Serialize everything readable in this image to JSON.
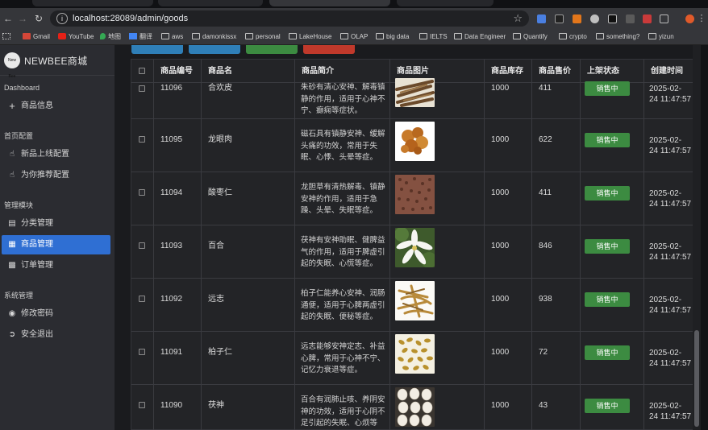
{
  "browser": {
    "url": "localhost:28089/admin/goods",
    "bookmarks": [
      "Gmail",
      "YouTube",
      "地图",
      "翻译",
      "aws",
      "damonkissx",
      "personal",
      "LakeHouse",
      "OLAP",
      "big data",
      "IELTS",
      "Data Engineer",
      "Quantify",
      "crypto",
      "something?",
      "yizun"
    ]
  },
  "sidebar": {
    "brand": "NEWBEE商城",
    "logo_text": "New Bee",
    "sections": {
      "dashboard": "Dashboard",
      "homepage": "首页配置",
      "modules": "管理模块",
      "system": "系统管理"
    },
    "items": {
      "goods_info": "商品信息",
      "new_config": "新品上线配置",
      "recommend_config": "为你推荐配置",
      "category": "分类管理",
      "goods": "商品管理",
      "orders": "订单管理",
      "password": "修改密码",
      "logout": "安全退出"
    }
  },
  "table": {
    "headers": [
      "商品编号",
      "商品名",
      "商品简介",
      "商品图片",
      "商品库存",
      "商品售价",
      "上架状态",
      "创建时间"
    ],
    "rows": [
      {
        "id": "11096",
        "name": "合欢皮",
        "desc": "朱砂有清心安神、解毒镇静的作用，适用于心神不宁、癫痫等症状。",
        "stock": "1000",
        "price": "411",
        "status": "销售中",
        "time1": "2025-02-",
        "time2": "24 11:47:57"
      },
      {
        "id": "11095",
        "name": "龙眼肉",
        "desc": "磁石具有镇静安神、缓解头痛的功效，常用于失眠、心悸、头晕等症。",
        "stock": "1000",
        "price": "622",
        "status": "销售中",
        "time1": "2025-02-",
        "time2": "24 11:47:57"
      },
      {
        "id": "11094",
        "name": "酸枣仁",
        "desc": "龙胆草有清热解毒、镇静安神的作用，适用于急躁、头晕、失眠等症。",
        "stock": "1000",
        "price": "411",
        "status": "销售中",
        "time1": "2025-02-",
        "time2": "24 11:47:57"
      },
      {
        "id": "11093",
        "name": "百合",
        "desc": "茯神有安神助眠、健脾益气的作用，适用于脾虚引起的失眠、心慌等症。",
        "stock": "1000",
        "price": "846",
        "status": "销售中",
        "time1": "2025-02-",
        "time2": "24 11:47:57"
      },
      {
        "id": "11092",
        "name": "远志",
        "desc": "柏子仁能养心安神、润肠通便，适用于心脾两虚引起的失眠、便秘等症。",
        "stock": "1000",
        "price": "938",
        "status": "销售中",
        "time1": "2025-02-",
        "time2": "24 11:47:57"
      },
      {
        "id": "11091",
        "name": "柏子仁",
        "desc": "远志能够安神定志、补益心脾，常用于心神不宁、记忆力衰退等症。",
        "stock": "1000",
        "price": "72",
        "status": "销售中",
        "time1": "2025-02-",
        "time2": "24 11:47:57"
      },
      {
        "id": "11090",
        "name": "茯神",
        "desc": "百合有润肺止咳、养阴安神的功效，适用于心阴不足引起的失眠、心烦等",
        "stock": "1000",
        "price": "43",
        "status": "销售中",
        "time1": "2025-02-",
        "time2": "24 11:47:57"
      }
    ]
  },
  "colors": {
    "accent": "#2f6fd3",
    "status_green": "#3c8b41",
    "sidebar_bg": "#2b2c31"
  }
}
